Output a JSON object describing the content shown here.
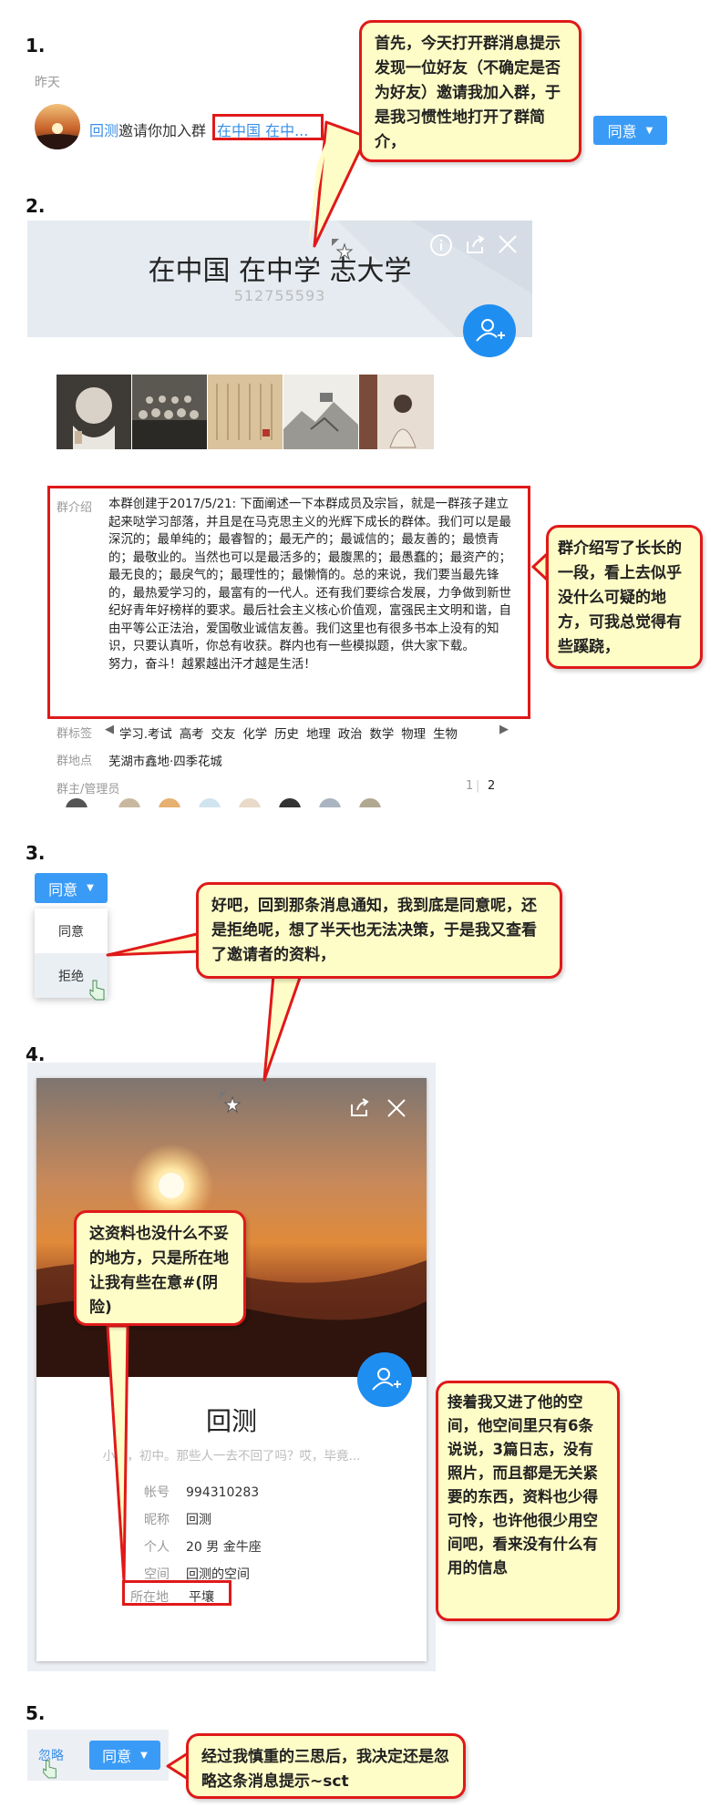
{
  "steps": [
    "1.",
    "2.",
    "3.",
    "4.",
    "5."
  ],
  "s1": {
    "date": "昨天",
    "inviter": "回测",
    "invite_text": "邀请你加入群",
    "group_link": "在中国 在中...",
    "accept_btn": "同意"
  },
  "s2": {
    "group_name": "在中国 在中学 志大学",
    "group_id": "512755593",
    "intro_label": "群介绍",
    "intro_text": "本群创建于2017/5/21: 下面阐述一下本群成员及宗旨，就是一群孩子建立起来哒学习部落，并且是在马克思主义的光辉下成长的群体。我们可以是最深沉的；最单纯的；最睿智的；最无产的；最诚信的；最友善的；最愤青的；最敬业的。当然也可以是最活多的；最腹黑的；最愚蠢的；最资产的；最无良的；最戾气的；最理性的；最懒惰的。总的来说，我们要当最先锋的，最热爱学习的，最富有的一代人。还有我们要综合发展，力争做到新世纪好青年好榜样的要求。最后社会主义核心价值观，富强民主文明和谐，自由平等公正法治，爱国敬业诚信友善。我们这里也有很多书本上没有的知识，只要认真听，你总有收获。群内也有一些模拟题，供大家下载。",
    "intro_last": "努力，奋斗！越累越出汗才越是生活！",
    "tag_label": "群标签",
    "tags": [
      "学习.考试",
      "高考",
      "交友",
      "化学",
      "历史",
      "地理",
      "政治",
      "数学",
      "物理",
      "生物"
    ],
    "loc_label": "群地点",
    "location": "芜湖市鑫地·四季花城",
    "admin_label": "群主/管理员",
    "pager": [
      "1",
      "2"
    ]
  },
  "s3": {
    "btn": "同意",
    "menu": [
      "同意",
      "拒绝"
    ]
  },
  "s4": {
    "name": "回测",
    "signature": "小学，初中。那些人一去不回了吗？哎，毕竟...",
    "fields": [
      {
        "label": "帐号",
        "value": "994310283"
      },
      {
        "label": "昵称",
        "value": "回测"
      },
      {
        "label": "个人",
        "value": "20 男 金牛座"
      },
      {
        "label": "空间",
        "value": "回测的空间"
      }
    ],
    "loc_label": "所在地",
    "loc_value": "平壤"
  },
  "s5": {
    "ignore": "忽略",
    "btn": "同意"
  },
  "callouts": {
    "c1": "首先，今天打开群消息提示发现一位好友（不确定是否为好友）邀请我加入群，于是我习惯性地打开了群简介，",
    "c2": "群介绍写了长长的一段，看上去似乎没什么可疑的地方，可我总觉得有些蹊跷，",
    "c3": "好吧，回到那条消息通知，我到底是同意呢，还是拒绝呢，想了半天也无法决策，于是我又查看了邀请者的资料，",
    "c4": "这资料也没什么不妥的地方，只是所在地让我有些在意#(阴险)",
    "c5": "接着我又进了他的空间，他空间里只有6条说说，3篇日志，没有照片，而且都是无关紧要的东西，资料也少得可怜，也许他很少用空间吧，看来没有什么有用的信息",
    "c6": "经过我慎重的三思后，我决定还是忽略这条消息提示~sct"
  },
  "colors": {
    "accent": "#3a9bf6",
    "callout_bg": "#fffdc7",
    "callout_border": "#e01919"
  }
}
